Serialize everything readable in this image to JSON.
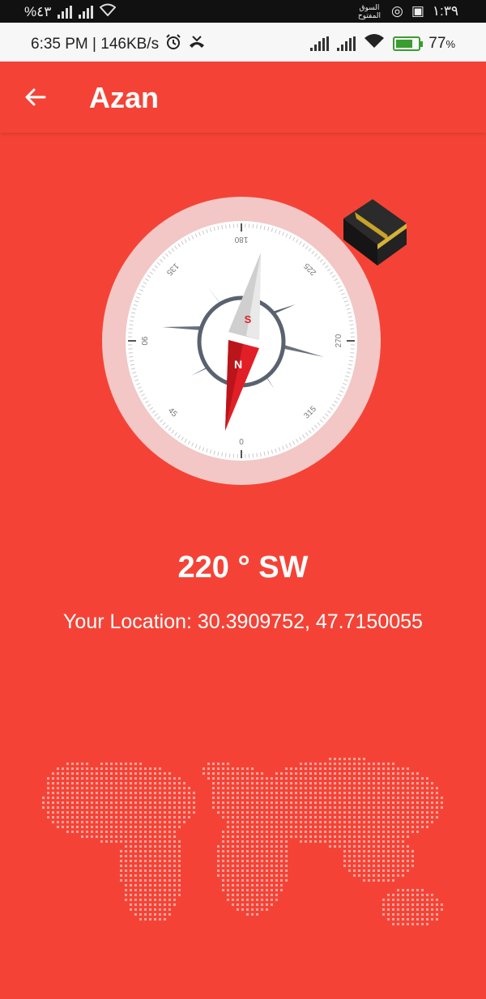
{
  "overlay": {
    "left_text": "%٤٣",
    "right_clock": "١:٣٩",
    "right_brand": "السوق المفتوح"
  },
  "status_bar": {
    "time_speed": "6:35 PM | 146KB/s",
    "battery_percent": "77",
    "battery_suffix": "%",
    "battery_level": 0.77,
    "icons": [
      "alarm-icon",
      "missed-call-icon",
      "signal-icon",
      "signal-icon",
      "wifi-icon",
      "battery-charging-icon"
    ]
  },
  "app_bar": {
    "back_icon": "arrow-back-icon",
    "title": "Azan"
  },
  "compass": {
    "dial_labels": [
      "180",
      "225",
      "270",
      "315",
      "0",
      "45",
      "90",
      "135"
    ],
    "needle_north": "N",
    "needle_south": "S",
    "colors": {
      "ring": "#f2c7c5",
      "needle_red": "#e21f26",
      "needle_gray": "#cfcfcf",
      "center_ring": "#5a6270"
    }
  },
  "heading": "220 ° SW",
  "location": "Your Location: 30.3909752, 47.7150055",
  "colors": {
    "background": "#f44336",
    "dots": "#f8a49c"
  }
}
